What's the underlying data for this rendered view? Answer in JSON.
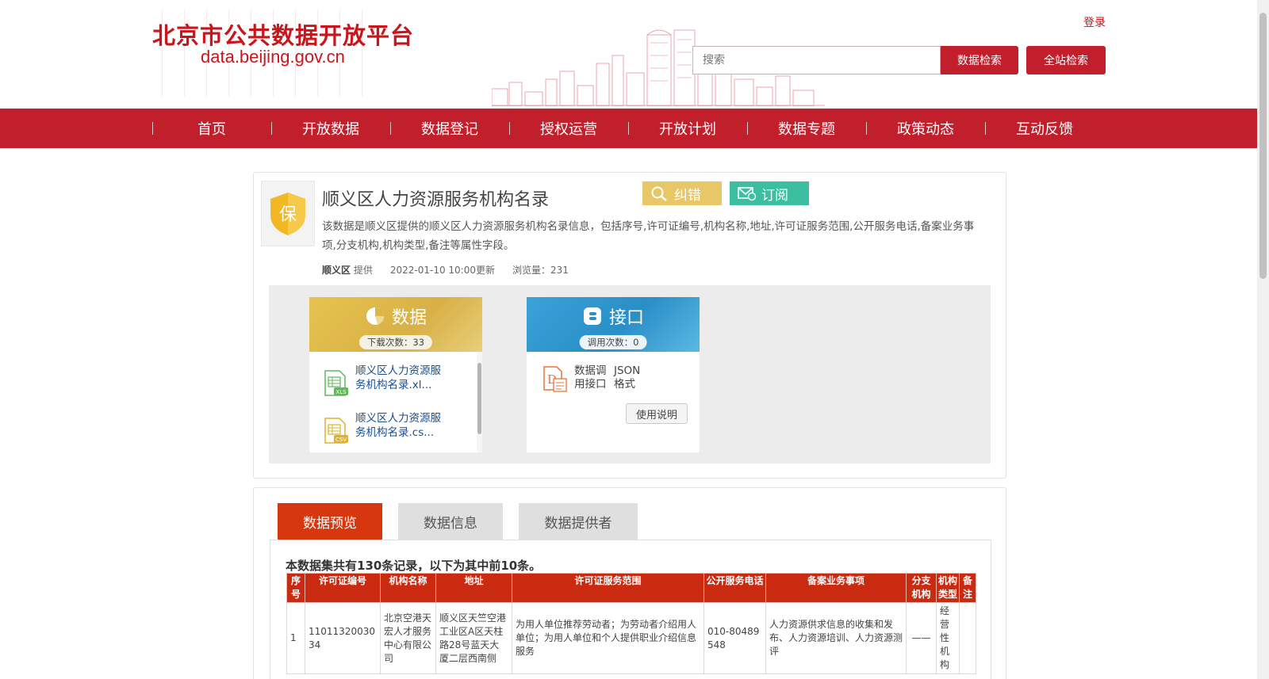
{
  "header": {
    "site_title": "北京市公共数据开放平台",
    "site_url": "data.beijing.gov.cn",
    "login": "登录",
    "search_placeholder": "搜索",
    "data_search": "数据检索",
    "site_search": "全站检索"
  },
  "nav": {
    "items": [
      "首页",
      "开放数据",
      "数据登记",
      "授权运营",
      "开放计划",
      "数据专题",
      "政策动态",
      "互动反馈"
    ]
  },
  "dataset": {
    "icon_glyph": "保",
    "title": "顺义区人力资源服务机构名录",
    "correct_label": "纠错",
    "subscribe_label": "订阅",
    "description": "该数据是顺义区提供的顺义区人力资源服务机构名录信息，包括序号,许可证编号,机构名称,地址,许可证服务范围,公开服务电话,备案业务事项,分支机构,机构类型,备注等属性字段。",
    "provider": "顺义区",
    "provider_suffix": "提供",
    "updated": "2022-01-10 10:00更新",
    "views": "浏览量：231"
  },
  "resources": {
    "data": {
      "title": "数据",
      "count": "下载次数：33",
      "files": [
        {
          "name": "顺义区人力资源服务机构名录.xl...",
          "type": "XLS"
        },
        {
          "name": "顺义区人力资源服务机构名录.cs...",
          "type": "CSV"
        }
      ]
    },
    "api": {
      "title": "接口",
      "count": "调用次数：0",
      "item_label": "数据调用接口",
      "item_format": "JSON格式",
      "usage_button": "使用说明"
    }
  },
  "tabs": {
    "preview": "数据预览",
    "info": "数据信息",
    "provider": "数据提供者"
  },
  "preview": {
    "summary": "本数据集共有130条记录，以下为其中前10条。",
    "columns": [
      "序号",
      "许可证编号",
      "机构名称",
      "地址",
      "许可证服务范围",
      "公开服务电话",
      "备案业务事项",
      "分支机构",
      "机构类型",
      "备注"
    ],
    "rows": [
      [
        "1",
        "1101132003034",
        "北京空港天宏人才服务中心有限公司",
        "顺义区天竺空港工业区A区天柱路28号蓝天大厦二层西南侧",
        "为用人单位推荐劳动者；为劳动者介绍用人单位；为用人单位和个人提供职业介绍信息服务",
        "010-80489548",
        "人力资源供求信息的收集和发布、人力资源培训、人力资源测评",
        "——",
        "经营性机构",
        ""
      ]
    ]
  },
  "colors": {
    "brand_red": "#c11f2c",
    "tab_active": "#d6370f",
    "correct_yellow": "#e7c766",
    "subscribe_green": "#3cbfa0"
  }
}
